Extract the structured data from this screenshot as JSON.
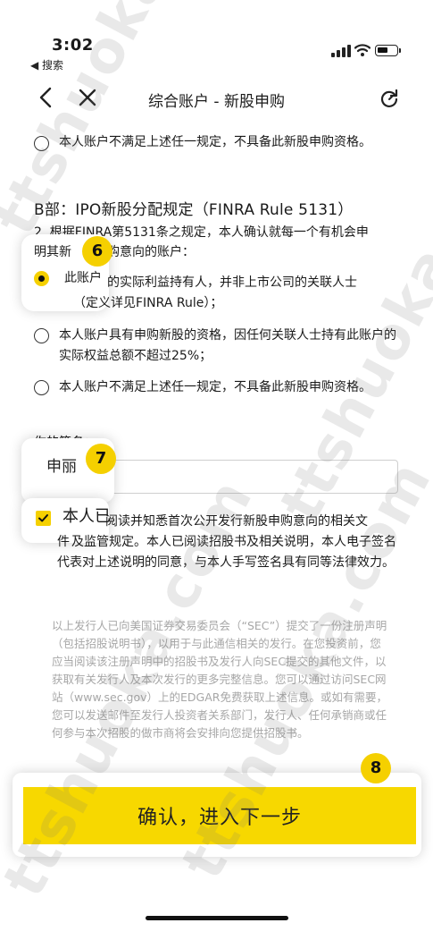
{
  "status_bar": {
    "time": "3:02",
    "back_app": "◀ 搜索"
  },
  "nav": {
    "title": "综合账户 - 新股申购"
  },
  "part_a": {
    "option_not_eligible": "本人账户不满足上述任一规定，不具备此新股申购资格。"
  },
  "part_b": {
    "title": "B部：IPO新股分配规定（FINRA Rule 5131）",
    "intro_visible_1": "2. 根据FINRA第5131条之规定，本人确认就每一个有机会申",
    "intro_visible_2": "明其新",
    "intro_visible_3": "购意向的账户：",
    "option1_line1": "此账户",
    "option1_line1b": "的实际利益持有人，并非上市公司的关联人士",
    "option1_line2": "（定义详见FINRA Rule）；",
    "option2": "本人账户具有申购新股的资格，因任何关联人士持有此账户的实际权益总额不超过25%；",
    "option3": "本人账户不满足上述任一规定，不具备此新股申购资格。"
  },
  "signature": {
    "label": "你的签名：",
    "value": "申丽"
  },
  "agreement": {
    "label_big": "本人已",
    "text_line1": "阅读并知悉首次公开发行新股申购意向的相关文",
    "text_line1_prefix": "件",
    "text_line1_rest": "及监管规定。本人已阅读招股书及相关说明，本人电子签名代表对上述说明的同意，与本人手写签名具有同等法律效力。"
  },
  "disclaimer": "以上发行人已向美国证券交易委员会（“SEC”）提交了一份注册声明（包括招股说明书），以用于与此通信相关的发行。在您投资前，您应当阅读该注册声明中的招股书及发行人向SEC提交的其他文件，以获取有关发行人及本次发行的更多完整信息。您可以通过访问SEC网站（www.sec.gov）上的EDGAR免费获取上述信息。或如有需要，您可以发送邮件至发行人投资者关系部门，发行人、任何承销商或任何参与本次招股的做市商将会安排向您提供招股书。",
  "confirm_button": "确认，进入下一步",
  "badges": {
    "b6": "6",
    "b7": "7",
    "b8": "8"
  },
  "watermark": "ttshuoka.com",
  "colors": {
    "accent_yellow": "#f7d800",
    "badge_yellow": "#f5d000",
    "disclaimer_gray": "#a7a7a7"
  }
}
